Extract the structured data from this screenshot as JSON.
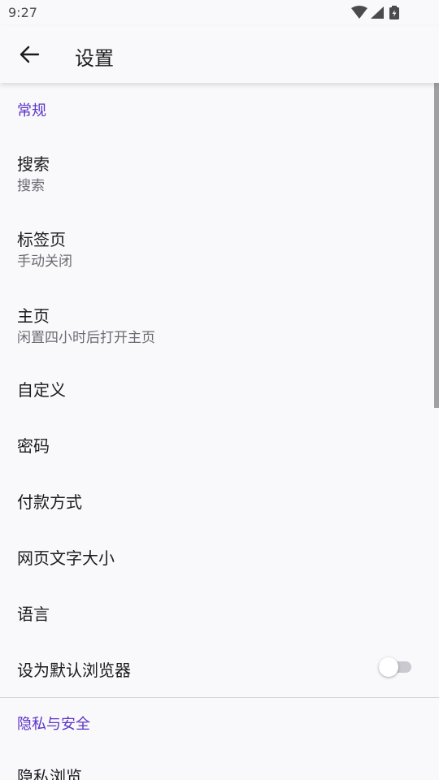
{
  "status_bar": {
    "time": "9:27",
    "icons": [
      "wifi-icon",
      "cellular-signal-icon",
      "battery-charging-icon"
    ]
  },
  "app_bar": {
    "back_icon": "arrow-left-icon",
    "title": "设置"
  },
  "colors": {
    "background": "#f9f9fc",
    "accent": "#5b33c7",
    "text_primary": "#1b1b1f",
    "text_secondary": "#6b6b72"
  },
  "sections": [
    {
      "header": "常规",
      "items": [
        {
          "title": "搜索",
          "subtitle": "搜索"
        },
        {
          "title": "标签页",
          "subtitle": "手动关闭"
        },
        {
          "title": "主页",
          "subtitle": "闲置四小时后打开主页"
        },
        {
          "title": "自定义"
        },
        {
          "title": "密码"
        },
        {
          "title": "付款方式"
        },
        {
          "title": "网页文字大小"
        },
        {
          "title": "语言"
        },
        {
          "title": "设为默认浏览器",
          "toggle": false
        }
      ]
    },
    {
      "header": "隐私与安全",
      "items": [
        {
          "title": "隐私浏览"
        }
      ]
    }
  ]
}
